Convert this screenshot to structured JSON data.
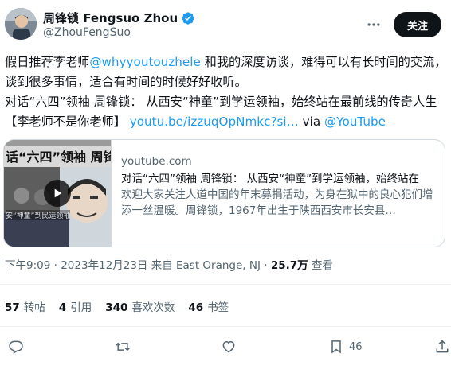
{
  "author": {
    "name": "周锋锁 Fengsuo Zhou",
    "handle": "@ZhouFengSuo",
    "verified": true
  },
  "follow_label": "关注",
  "tweet": {
    "line1_a": "假日推荐李老师",
    "mention": "@whyyoutouzhele",
    "line1_b": " 和我的深度访谈，难得可以有长时间的交流，谈到很多事情，适合有时间的时候好好收听。",
    "line2_a": "对话“六四”领袖 周锋锁： 从西安“神童”到学运领袖，始终站在最前线的传奇人生【李老师不是你老师】 ",
    "link": "youtu.be/izzuqOpNmkc?si…",
    "via": " via ",
    "via_link": "@YouTube"
  },
  "card": {
    "domain": "youtube.com",
    "title": "对话“六四”领袖 周锋锁： 从西安“神童”到学运领袖，始终站在",
    "description": "欢迎大家关注人道中国的年末募捐活动，为身在狱中的良心犯们增添一丝温暖。周锋锁，1967年出生于陕西西安市长安县…",
    "thumb_text_top": "话“六四”领袖 周锋",
    "thumb_text_bottom": "安“神童”到民运领袖"
  },
  "meta": {
    "time_date": "下午9:09 · 2023年12月23日 来自 East Orange, NJ · ",
    "views": "25.7万",
    "views_label": " 查看"
  },
  "stats": {
    "retweets": "57",
    "retweets_label": "转帖",
    "quotes": "4",
    "quotes_label": "引用",
    "likes": "340",
    "likes_label": "喜欢次数",
    "bookmarks": "46",
    "bookmarks_label": "书签"
  },
  "actions": {
    "bookmark_count": "46"
  },
  "colors": {
    "link": "#1d9bf0",
    "text": "#0f1419",
    "secondary": "#536471",
    "border": "#cfd9de"
  }
}
